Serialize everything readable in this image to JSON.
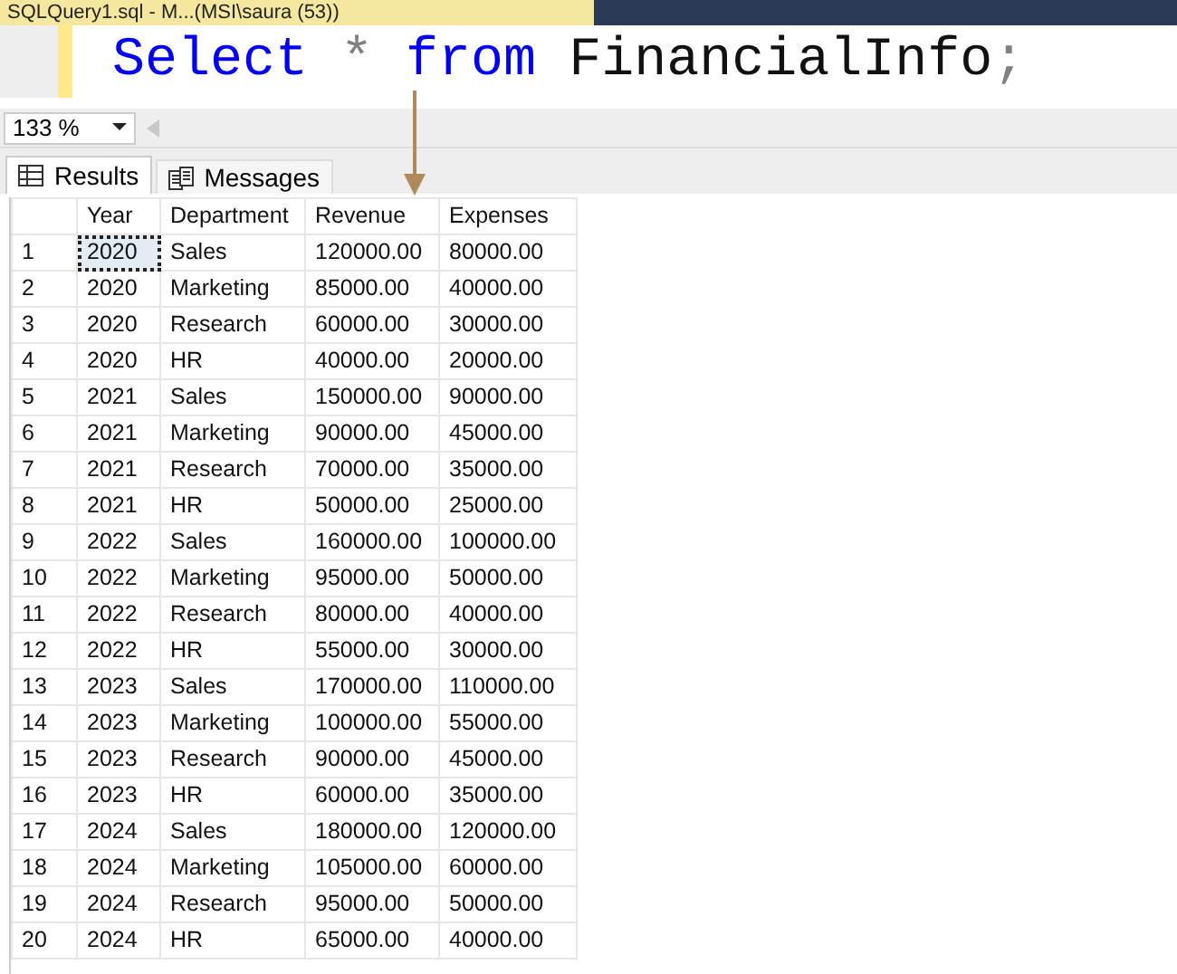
{
  "document_tab": {
    "title": "SQLQuery1.sql - M...(MSI\\saura (53))"
  },
  "editor": {
    "tokens": [
      {
        "text": "Select",
        "kind": "keyword"
      },
      {
        "text": " * ",
        "kind": "operator"
      },
      {
        "text": "from",
        "kind": "keyword"
      },
      {
        "text": " FinancialInfo",
        "kind": "plain"
      },
      {
        "text": ";",
        "kind": "operator"
      }
    ]
  },
  "zoom": {
    "value": "133 %"
  },
  "result_tabs": [
    {
      "label": "Results",
      "selected": true
    },
    {
      "label": "Messages",
      "selected": false
    }
  ],
  "table": {
    "columns": [
      "Year",
      "Department",
      "Revenue",
      "Expenses"
    ],
    "rows": [
      {
        "number": "1",
        "cells": [
          "2020",
          "Sales",
          "120000.00",
          "80000.00"
        ],
        "focused": true
      },
      {
        "number": "2",
        "cells": [
          "2020",
          "Marketing",
          "85000.00",
          "40000.00"
        ],
        "focused": false
      },
      {
        "number": "3",
        "cells": [
          "2020",
          "Research",
          "60000.00",
          "30000.00"
        ],
        "focused": false
      },
      {
        "number": "4",
        "cells": [
          "2020",
          "HR",
          "40000.00",
          "20000.00"
        ],
        "focused": false
      },
      {
        "number": "5",
        "cells": [
          "2021",
          "Sales",
          "150000.00",
          "90000.00"
        ],
        "focused": false
      },
      {
        "number": "6",
        "cells": [
          "2021",
          "Marketing",
          "90000.00",
          "45000.00"
        ],
        "focused": false
      },
      {
        "number": "7",
        "cells": [
          "2021",
          "Research",
          "70000.00",
          "35000.00"
        ],
        "focused": false
      },
      {
        "number": "8",
        "cells": [
          "2021",
          "HR",
          "50000.00",
          "25000.00"
        ],
        "focused": false
      },
      {
        "number": "9",
        "cells": [
          "2022",
          "Sales",
          "160000.00",
          "100000.00"
        ],
        "focused": false
      },
      {
        "number": "10",
        "cells": [
          "2022",
          "Marketing",
          "95000.00",
          "50000.00"
        ],
        "focused": false
      },
      {
        "number": "11",
        "cells": [
          "2022",
          "Research",
          "80000.00",
          "40000.00"
        ],
        "focused": false
      },
      {
        "number": "12",
        "cells": [
          "2022",
          "HR",
          "55000.00",
          "30000.00"
        ],
        "focused": false
      },
      {
        "number": "13",
        "cells": [
          "2023",
          "Sales",
          "170000.00",
          "110000.00"
        ],
        "focused": false
      },
      {
        "number": "14",
        "cells": [
          "2023",
          "Marketing",
          "100000.00",
          "55000.00"
        ],
        "focused": false
      },
      {
        "number": "15",
        "cells": [
          "2023",
          "Research",
          "90000.00",
          "45000.00"
        ],
        "focused": false
      },
      {
        "number": "16",
        "cells": [
          "2023",
          "HR",
          "60000.00",
          "35000.00"
        ],
        "focused": false
      },
      {
        "number": "17",
        "cells": [
          "2024",
          "Sales",
          "180000.00",
          "120000.00"
        ],
        "focused": false
      },
      {
        "number": "18",
        "cells": [
          "2024",
          "Marketing",
          "105000.00",
          "60000.00"
        ],
        "focused": false
      },
      {
        "number": "19",
        "cells": [
          "2024",
          "Research",
          "95000.00",
          "50000.00"
        ],
        "focused": false
      },
      {
        "number": "20",
        "cells": [
          "2024",
          "HR",
          "65000.00",
          "40000.00"
        ],
        "focused": false
      }
    ]
  }
}
